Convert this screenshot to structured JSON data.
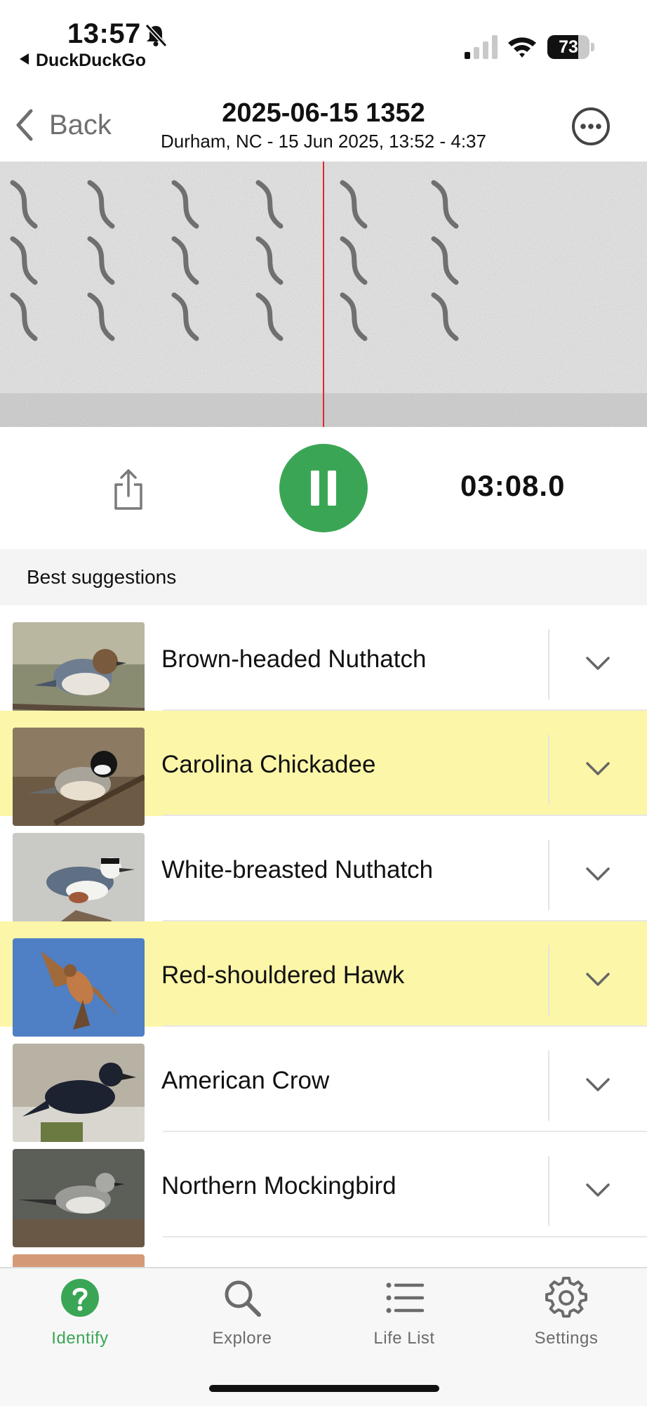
{
  "status_bar": {
    "time": "13:57",
    "back_app": "DuckDuckGo",
    "battery_percent": 73,
    "battery_label": "73"
  },
  "nav": {
    "back_label": "Back",
    "title": "2025-06-15 1352",
    "subtitle": "Durham, NC - 15 Jun 2025, 13:52 - 4:37"
  },
  "player": {
    "timer": "03:08.0"
  },
  "section": {
    "header": "Best suggestions"
  },
  "suggestions": [
    {
      "name": "Brown-headed Nuthatch",
      "highlighted": false
    },
    {
      "name": "Carolina Chickadee",
      "highlighted": true
    },
    {
      "name": "White-breasted Nuthatch",
      "highlighted": false
    },
    {
      "name": "Red-shouldered Hawk",
      "highlighted": true
    },
    {
      "name": "American Crow",
      "highlighted": false
    },
    {
      "name": "Northern Mockingbird",
      "highlighted": false
    }
  ],
  "tabs": [
    {
      "label": "Identify",
      "icon": "question-circle-icon",
      "active": true
    },
    {
      "label": "Explore",
      "icon": "search-icon",
      "active": false
    },
    {
      "label": "Life List",
      "icon": "list-icon",
      "active": false
    },
    {
      "label": "Settings",
      "icon": "gear-icon",
      "active": false
    }
  ],
  "colors": {
    "accent_green": "#3aa655",
    "highlight_yellow": "#fcf6a8",
    "playhead_red": "#e3242b"
  }
}
